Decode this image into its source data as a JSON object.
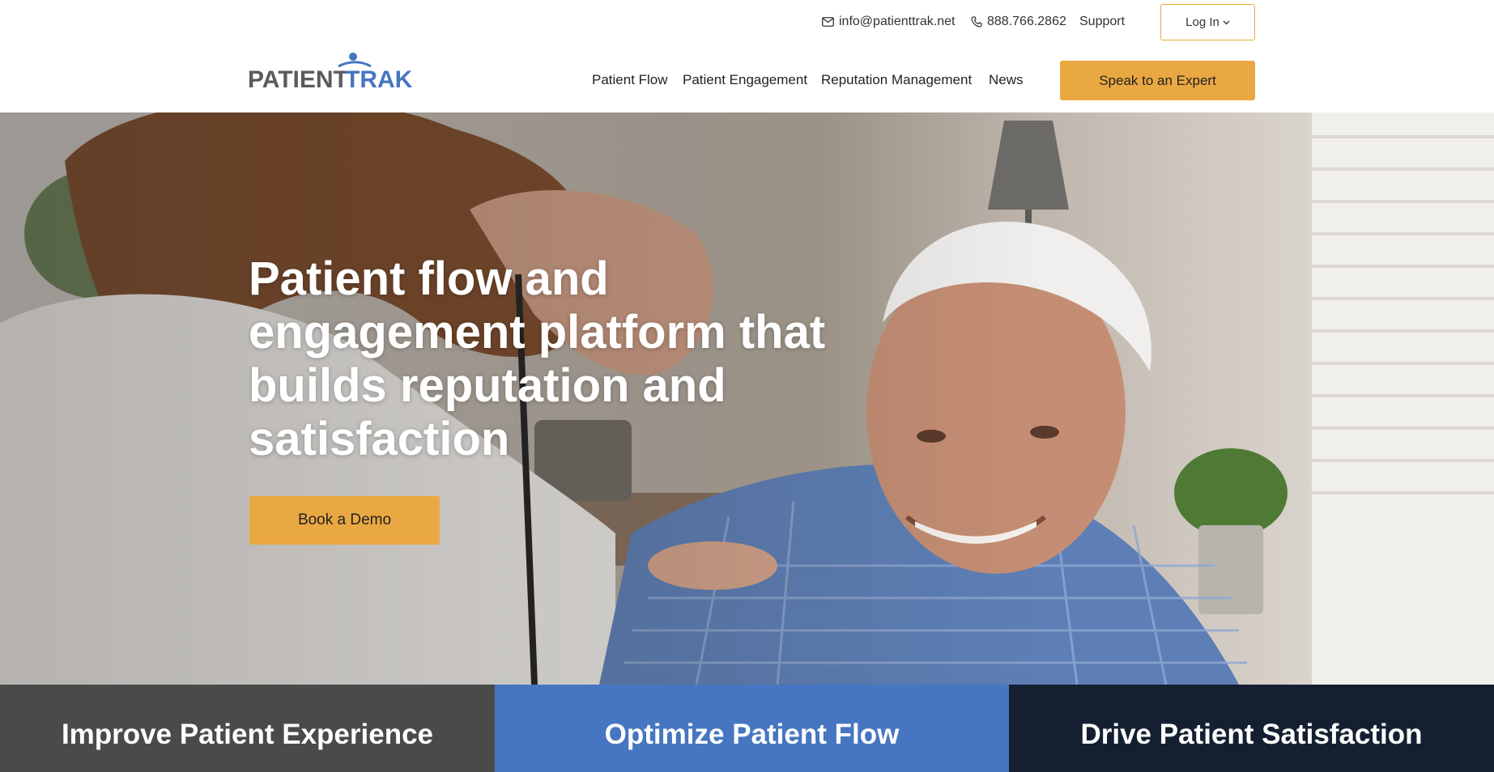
{
  "header": {
    "email": "info@patienttrak.net",
    "phone": "888.766.2862",
    "support": "Support",
    "login": "Log In"
  },
  "logo": {
    "text_gray": "PATIENT",
    "text_blue": "TRAK"
  },
  "nav": {
    "items": [
      "Patient Flow",
      "Patient Engagement",
      "Reputation Management",
      "News"
    ],
    "cta": "Speak to an Expert"
  },
  "hero": {
    "title": "Patient flow and engagement platform that builds reputation and satisfaction",
    "button": "Book a Demo"
  },
  "features": [
    "Improve Patient Experience",
    "Optimize Patient Flow",
    "Drive Patient Satisfaction"
  ],
  "colors": {
    "accent": "#eaa843",
    "brand_blue": "#4676c1",
    "brand_gray": "#5b5b5b",
    "strip_gray": "#4a4a4a",
    "strip_navy": "#142032"
  }
}
